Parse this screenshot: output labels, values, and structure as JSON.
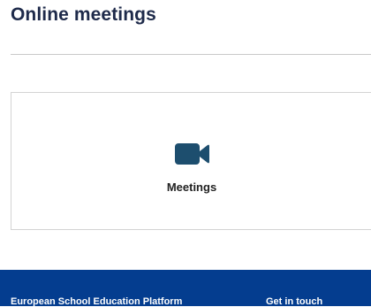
{
  "page": {
    "title": "Online meetings"
  },
  "card": {
    "icon": "video-camera-icon",
    "label": "Meetings"
  },
  "footer": {
    "left_link": "European School Education Platform",
    "right_link": "Get in touch"
  },
  "colors": {
    "title": "#1e2a4a",
    "icon": "#1d4e6e",
    "footer_bg": "#043d8f"
  }
}
